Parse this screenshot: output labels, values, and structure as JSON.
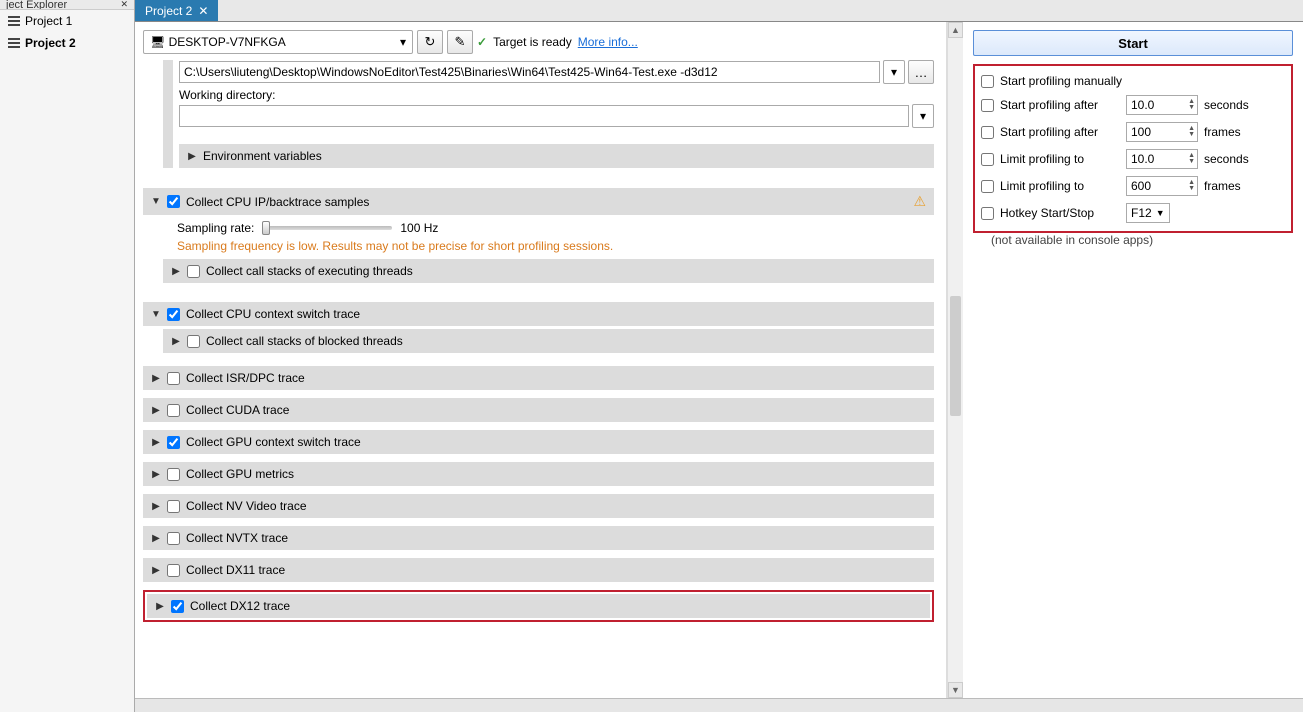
{
  "sidebar": {
    "header": "ject Explorer",
    "items": [
      {
        "label": "Project 1"
      },
      {
        "label": "Project 2"
      }
    ],
    "active_index": 1
  },
  "tab": {
    "label": "Project 2"
  },
  "header": {
    "target_device": "DESKTOP-V7NFKGA",
    "target_ready": "Target is ready",
    "more_info": "More info..."
  },
  "command": {
    "path": "C:\\Users\\liuteng\\Desktop\\WindowsNoEditor\\Test425\\Binaries\\Win64\\Test425-Win64-Test.exe -d3d12",
    "working_dir_label": "Working directory:",
    "working_dir_value": "",
    "env_vars_label": "Environment variables"
  },
  "sections": {
    "cpu_ip": {
      "label": "Collect CPU IP/backtrace samples",
      "sampling_label": "Sampling rate:",
      "sampling_hz": "100 Hz",
      "warning": "Sampling frequency is low. Results may not be precise for short profiling sessions.",
      "callstack_exec": "Collect call stacks of executing threads"
    },
    "ctx_switch": {
      "label": "Collect CPU context switch trace",
      "callstack_blocked": "Collect call stacks of blocked threads"
    },
    "isr": {
      "label": "Collect ISR/DPC trace"
    },
    "cuda": {
      "label": "Collect CUDA trace"
    },
    "gpu_ctx": {
      "label": "Collect GPU context switch trace"
    },
    "gpu_metrics": {
      "label": "Collect GPU metrics"
    },
    "nv_video": {
      "label": "Collect NV Video trace"
    },
    "nvtx": {
      "label": "Collect NVTX trace"
    },
    "dx11": {
      "label": "Collect DX11 trace"
    },
    "dx12": {
      "label": "Collect DX12 trace"
    }
  },
  "right": {
    "start": "Start",
    "opts": {
      "manual": "Start profiling manually",
      "after_sec": {
        "label": "Start profiling after",
        "value": "10.0",
        "unit": "seconds"
      },
      "after_frames": {
        "label": "Start profiling after",
        "value": "100",
        "unit": "frames"
      },
      "limit_sec": {
        "label": "Limit profiling to",
        "value": "10.0",
        "unit": "seconds"
      },
      "limit_frames": {
        "label": "Limit profiling to",
        "value": "600",
        "unit": "frames"
      },
      "hotkey": {
        "label": "Hotkey Start/Stop",
        "value": "F12"
      }
    },
    "note": "(not available in console apps)"
  }
}
